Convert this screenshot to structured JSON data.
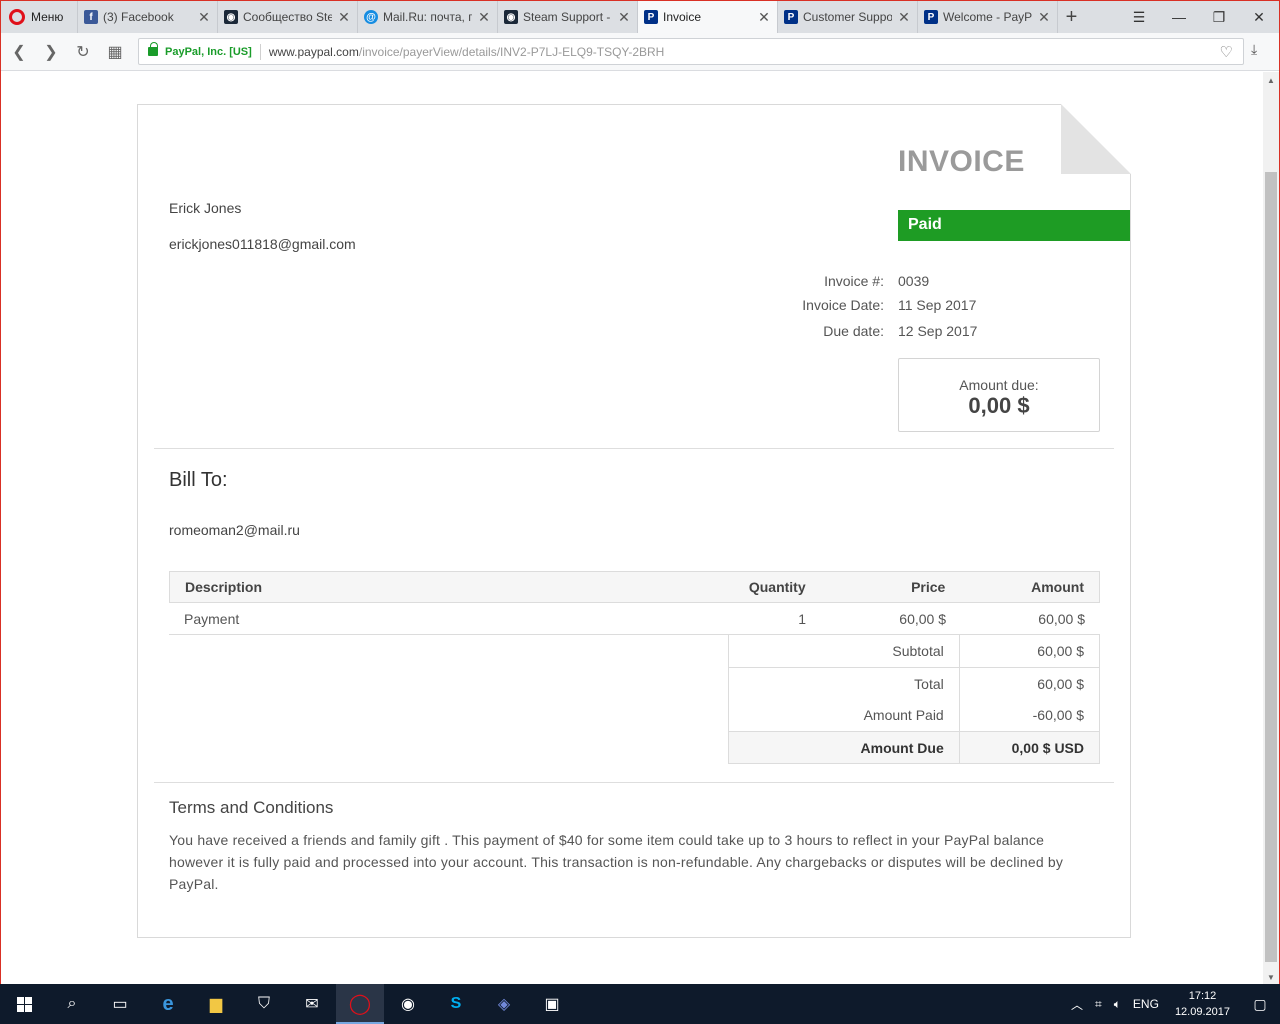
{
  "browser": {
    "menu_label": "Меню",
    "tabs": [
      {
        "label": "(3) Facebook",
        "icon": "facebook-icon",
        "color": "#3b5998"
      },
      {
        "label": "Сообщество Ste",
        "icon": "steam-icon",
        "color": "#1b2838"
      },
      {
        "label": "Mail.Ru: почта, п",
        "icon": "mailru-icon",
        "color": "#168de2"
      },
      {
        "label": "Steam Support -",
        "icon": "steam-icon",
        "color": "#1b2838"
      },
      {
        "label": "Invoice",
        "icon": "paypal-icon",
        "color": "#003087"
      },
      {
        "label": "Customer Suppo",
        "icon": "paypal-icon",
        "color": "#003087"
      },
      {
        "label": "Welcome - PayP",
        "icon": "paypal-icon",
        "color": "#003087"
      }
    ],
    "cert_label": "PayPal, Inc. [US]",
    "url_host": "www.paypal.com",
    "url_path": "/invoice/payerView/details/INV2-P7LJ-ELQ9-TSQY-2BRH"
  },
  "invoice": {
    "title": "INVOICE",
    "status": "Paid",
    "status_color": "#1e9c24",
    "sender_name": "Erick Jones",
    "sender_email": "erickjones011818@gmail.com",
    "meta": {
      "number_label": "Invoice #:",
      "number": "0039",
      "date_label": "Invoice Date:",
      "date": "11 Sep 2017",
      "due_label": "Due date:",
      "due": "12 Sep 2017"
    },
    "amount_due_label": "Amount due:",
    "amount_due_value": "0,00 $",
    "bill_to_heading": "Bill To:",
    "bill_to_email": "romeoman2@mail.ru",
    "table": {
      "headers": {
        "description": "Description",
        "quantity": "Quantity",
        "price": "Price",
        "amount": "Amount"
      },
      "rows": [
        {
          "description": "Payment",
          "quantity": "1",
          "price": "60,00 $",
          "amount": "60,00 $"
        }
      ]
    },
    "totals": {
      "subtotal_label": "Subtotal",
      "subtotal": "60,00 $",
      "total_label": "Total",
      "total": "60,00 $",
      "paid_label": "Amount Paid",
      "paid": "-60,00 $",
      "due_label": "Amount Due",
      "due": "0,00 $ USD"
    },
    "terms_heading": "Terms and Conditions",
    "terms_body": "You have received a friends and family gift . This payment of $40 for some item could take up to 3 hours to reflect in your PayPal balance however it is fully paid and processed into your account. This transaction is non-refundable. Any chargebacks or disputes will be declined by PayPal."
  },
  "taskbar": {
    "language": "ENG",
    "time": "17:12",
    "date": "12.09.2017"
  }
}
